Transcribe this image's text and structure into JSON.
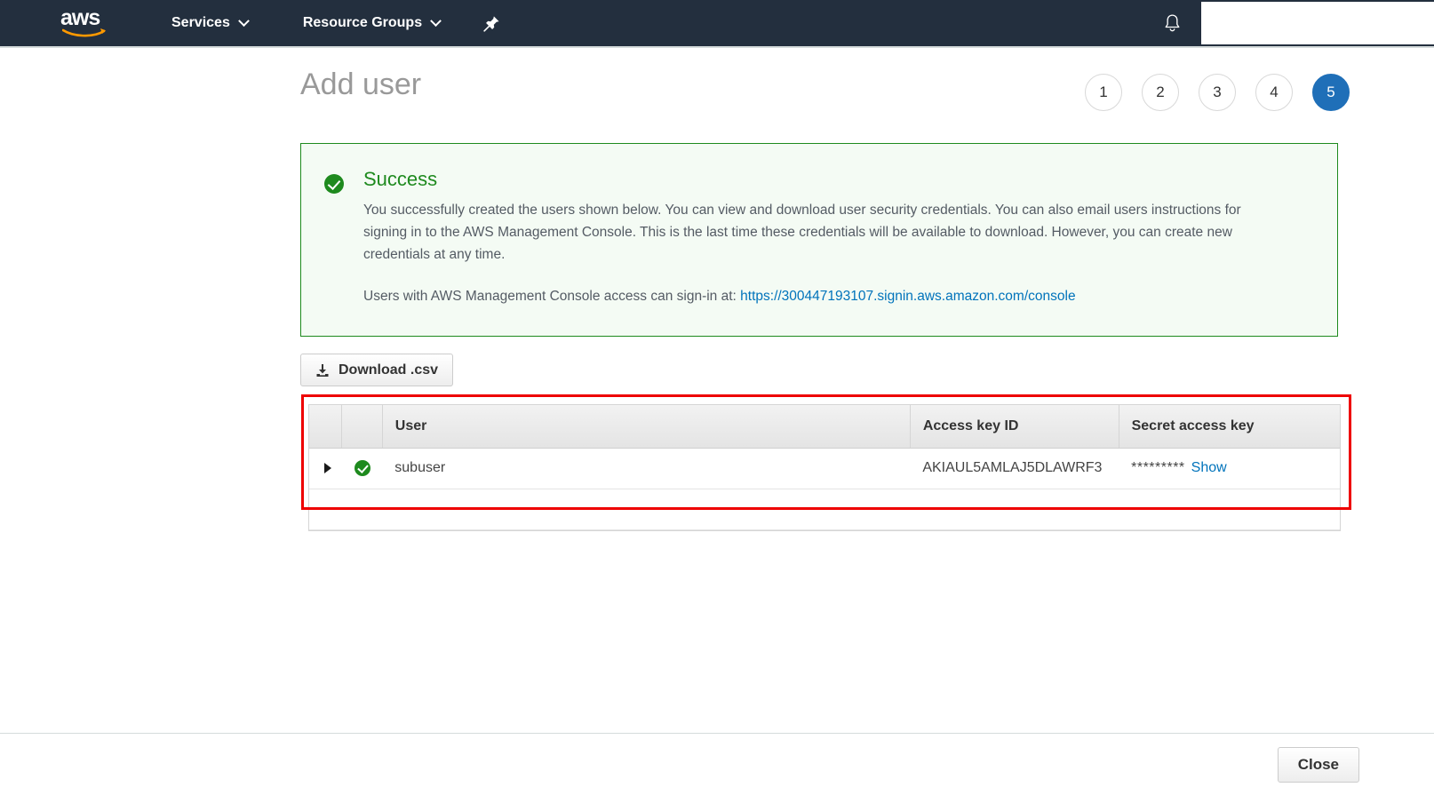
{
  "navbar": {
    "logo_text": "aws",
    "logo_icon": "aws-smile-logo",
    "services_label": "Services",
    "resource_groups_label": "Resource Groups",
    "pin_icon": "pin-icon",
    "bell_icon": "bell-notification-icon",
    "caret_icon": "chevron-down-icon",
    "account_area": ""
  },
  "page": {
    "title": "Add user",
    "steps": [
      {
        "label": "1",
        "active": false
      },
      {
        "label": "2",
        "active": false
      },
      {
        "label": "3",
        "active": false
      },
      {
        "label": "4",
        "active": false
      },
      {
        "label": "5",
        "active": true
      }
    ]
  },
  "alert": {
    "icon": "success-check-circle-icon",
    "title": "Success",
    "body": "You successfully created the users shown below. You can view and download user security credentials. You can also email users instructions for signing in to the AWS Management Console. This is the last time these credentials will be available to download. However, you can create new credentials at any time.",
    "signin_prefix": "Users with AWS Management Console access can sign-in at:",
    "signin_url": "https://300447193107.signin.aws.amazon.com/console",
    "border_color": "#1e8a1e",
    "background_color": "#f4fbf4",
    "title_color": "#1e8a1e",
    "link_color": "#0073bb"
  },
  "download": {
    "label": "Download .csv",
    "icon": "download-icon"
  },
  "table": {
    "highlight_color": "#ee0000",
    "columns": [
      "",
      "",
      "User",
      "Access key ID",
      "Secret access key"
    ],
    "rows": [
      {
        "expand_icon": "expand-triangle-icon",
        "status_icon": "success-check-circle-icon",
        "user": "subuser",
        "access_key_id": "AKIAUL5AMLAJ5DLAWRF3",
        "secret_masked": "*********",
        "show_label": "Show"
      }
    ]
  },
  "footer": {
    "close_label": "Close"
  }
}
